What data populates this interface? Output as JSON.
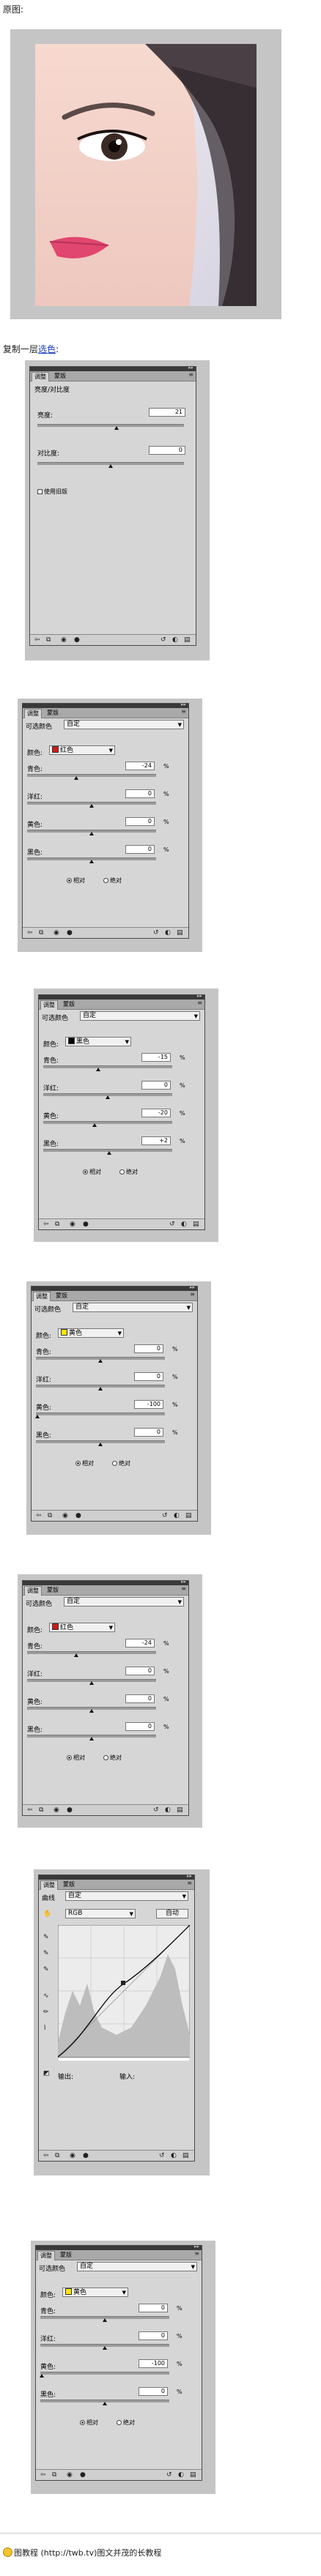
{
  "captions": {
    "original": "原图:",
    "duplicate_prefix": "复制一层",
    "duplicate_link": "选色",
    "duplicate_suffix": ":"
  },
  "tabs": {
    "adjust": "调整",
    "mask": "蒙版"
  },
  "panel1": {
    "title": "亮度/对比度",
    "brightness_label": "亮度:",
    "brightness_value": "21",
    "contrast_label": "对比度:",
    "contrast_value": "0",
    "legacy_label": "使用旧版"
  },
  "selective": {
    "title": "可选颜色",
    "preset_value": "自定",
    "color_label": "颜色:",
    "cyan": "青色:",
    "magenta": "洋红:",
    "yellow": "黄色:",
    "black": "黑色:",
    "relative": "相对",
    "absolute": "绝对"
  },
  "panel2": {
    "color": "红色",
    "swatch": "#cc1b1b",
    "cyan": "-24",
    "magenta": "0",
    "yellow": "0",
    "black": "0"
  },
  "panel3": {
    "color": "黑色",
    "swatch": "#000000",
    "cyan": "-15",
    "magenta": "0",
    "yellow": "-20",
    "black": "+2"
  },
  "panel4": {
    "color": "黄色",
    "swatch": "#ffe60a",
    "cyan": "0",
    "magenta": "0",
    "yellow": "-100",
    "black": "0"
  },
  "panel5": {
    "color": "红色",
    "swatch": "#cc1b1b",
    "cyan": "-24",
    "magenta": "0",
    "yellow": "0",
    "black": "0"
  },
  "curves": {
    "title": "曲线",
    "preset_value": "自定",
    "channel_value": "RGB",
    "auto_label": "自动",
    "output_label": "输出:",
    "input_label": "输入:"
  },
  "panel7": {
    "color": "黄色",
    "swatch": "#ffe60a",
    "cyan": "0",
    "magenta": "0",
    "yellow": "-100",
    "black": "0"
  },
  "percent": "%",
  "footer": {
    "text": "图教程 (http://twb.tv)图文并茂的长教程"
  }
}
